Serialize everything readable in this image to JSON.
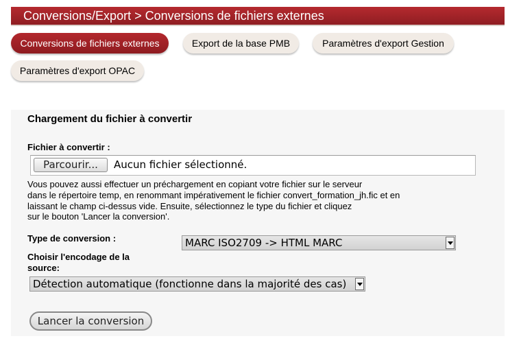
{
  "header": {
    "title": "Conversions/Export > Conversions de fichiers externes"
  },
  "tabs": [
    {
      "label": "Conversions de fichiers externes",
      "active": true
    },
    {
      "label": "Export de la base PMB",
      "active": false
    },
    {
      "label": "Paramètres d'export Gestion",
      "active": false
    },
    {
      "label": "Paramètres d'export OPAC",
      "active": false
    }
  ],
  "form": {
    "section_title": "Chargement du fichier à convertir",
    "file_label": "Fichier à convertir :",
    "browse_button": "Parcourir...",
    "file_status": "Aucun fichier sélectionné.",
    "help_lines": [
      "Vous pouvez aussi effectuer un préchargement en copiant votre fichier sur le serveur",
      "dans le répertoire temp, en renommant impérativement le fichier convert_formation_jh.fic et en",
      "laissant le champ ci-dessus vide. Ensuite, sélectionnez le type du fichier et cliquez",
      "sur le bouton 'Lancer la conversion'."
    ],
    "conversion_type_label": "Type de conversion :",
    "conversion_type_value": "MARC ISO2709 -> HTML MARC",
    "encoding_label_line1": "Choisir l'encodage de la",
    "encoding_label_line2": "source:",
    "encoding_value": "Détection automatique (fonctionne dans la majorité des cas)",
    "launch_button": "Lancer la conversion"
  },
  "colors": {
    "accent": "#a32227",
    "tab_inactive": "#f1ebe5",
    "panel_bg": "#f6f6f6"
  }
}
